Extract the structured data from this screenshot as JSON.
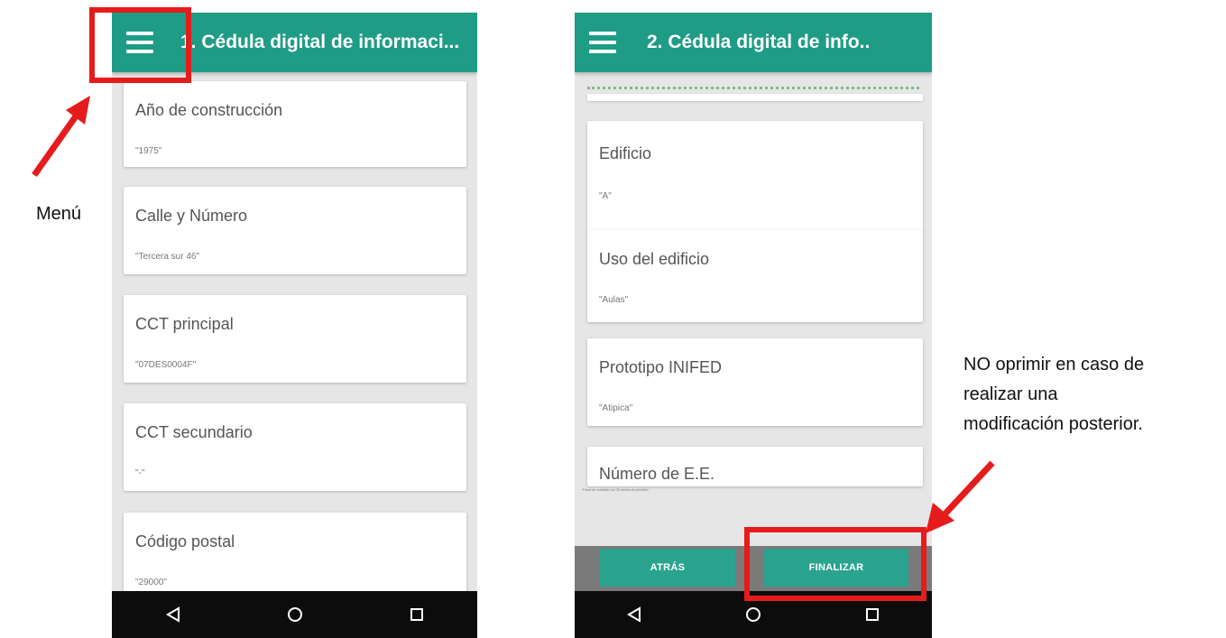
{
  "left_screen": {
    "title": "1. Cédula digital de informaci...",
    "menu_icon": "hamburger-menu-icon",
    "fields": [
      {
        "label": "Año de construcción",
        "value": "\"1975\""
      },
      {
        "label": "Calle y Número",
        "value": "\"Tercera sur 46\""
      },
      {
        "label": "CCT principal",
        "value": "\"07DES0004F\""
      },
      {
        "label": "CCT secundario",
        "value": "\"-\""
      },
      {
        "label": "Código postal",
        "value": "\"29000\""
      }
    ]
  },
  "right_screen": {
    "title": "2. Cédula digital de info..",
    "menu_icon": "hamburger-menu-icon",
    "fields": [
      {
        "label": "Edificio",
        "value": "\"A\""
      },
      {
        "label": "Uso del edificio",
        "value": "\"Aulas\""
      },
      {
        "label": "Prototipo INIFED",
        "value": "\"Atipica\""
      },
      {
        "label": "Número de E.E.",
        "value": ""
      }
    ],
    "footnote": "*Favor de contestar con 30 metros de precisión",
    "back_label": "ATRÁS",
    "finish_label": "FINALIZAR"
  },
  "navbar": {
    "icons": [
      "back-triangle-icon",
      "home-circle-icon",
      "recents-square-icon"
    ]
  },
  "annotations": {
    "menu_label": "Menú",
    "finish_note_line1": "NO oprimir en caso de",
    "finish_note_line2": "realizar una",
    "finish_note_line3": "modificación posterior."
  },
  "colors": {
    "appbar": "#1e9c86",
    "button": "#2aa38f",
    "highlight": "#e61b1b"
  }
}
